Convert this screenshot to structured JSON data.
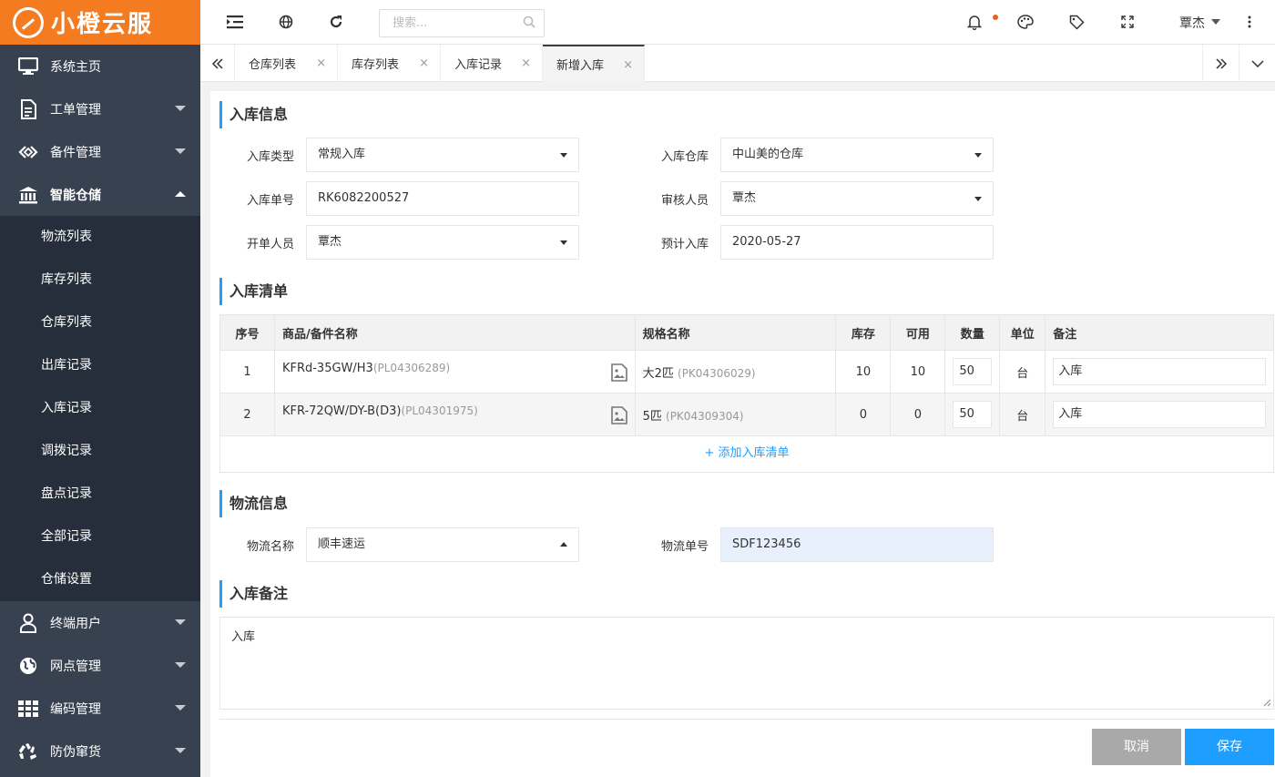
{
  "app": {
    "name": "小橙云服"
  },
  "sidebar": {
    "items": [
      {
        "label": "系统主页",
        "icon": "monitor-icon"
      },
      {
        "label": "工单管理",
        "icon": "document-icon"
      },
      {
        "label": "备件管理",
        "icon": "parts-icon"
      },
      {
        "label": "智能仓储",
        "icon": "warehouse-icon"
      },
      {
        "label": "终端用户",
        "icon": "user-icon"
      },
      {
        "label": "网点管理",
        "icon": "globe-icon"
      },
      {
        "label": "编码管理",
        "icon": "grid-icon"
      },
      {
        "label": "防伪窜货",
        "icon": "recycle-icon"
      }
    ],
    "submenu": [
      "物流列表",
      "库存列表",
      "仓库列表",
      "出库记录",
      "入库记录",
      "调拨记录",
      "盘点记录",
      "全部记录",
      "仓储设置"
    ]
  },
  "topbar": {
    "search_placeholder": "搜索...",
    "user_name": "覃杰"
  },
  "tabs": [
    "仓库列表",
    "库存列表",
    "入库记录",
    "新增入库"
  ],
  "form": {
    "section_info": "入库信息",
    "type_label": "入库类型",
    "type_value": "常规入库",
    "warehouse_label": "入库仓库",
    "warehouse_value": "中山美的仓库",
    "order_label": "入库单号",
    "order_value": "RK6082200527",
    "auditor_label": "审核人员",
    "auditor_value": "覃杰",
    "creator_label": "开单人员",
    "creator_value": "覃杰",
    "date_label": "预计入库",
    "date_value": "2020-05-27"
  },
  "list": {
    "title": "入库清单",
    "headers": [
      "序号",
      "商品/备件名称",
      "规格名称",
      "库存",
      "可用",
      "数量",
      "单位",
      "备注"
    ],
    "rows": [
      {
        "no": "1",
        "name": "KFRd-35GW/H3",
        "code": "(PL04306289)",
        "spec": "大2匹",
        "spec_code": "(PK04306029)",
        "stock": "10",
        "avail": "10",
        "qty": "50",
        "unit": "台",
        "remark": "入库"
      },
      {
        "no": "2",
        "name": "KFR-72QW/DY-B(D3)",
        "code": "(PL04301975)",
        "spec": "5匹",
        "spec_code": "(PK04309304)",
        "stock": "0",
        "avail": "0",
        "qty": "50",
        "unit": "台",
        "remark": "入库"
      }
    ],
    "add_label": "+ 添加入库清单"
  },
  "logistics": {
    "title": "物流信息",
    "name_label": "物流名称",
    "name_value": "顺丰速运",
    "no_label": "物流单号",
    "no_value": "SDF123456"
  },
  "remark": {
    "title": "入库备注",
    "value": "入库"
  },
  "buttons": {
    "cancel": "取消",
    "save": "保存"
  },
  "colors": {
    "brand": "#f47b20",
    "sidebar": "#384150",
    "primary": "#1e9fff",
    "logistics_no_bg": "#e8f0fe"
  }
}
